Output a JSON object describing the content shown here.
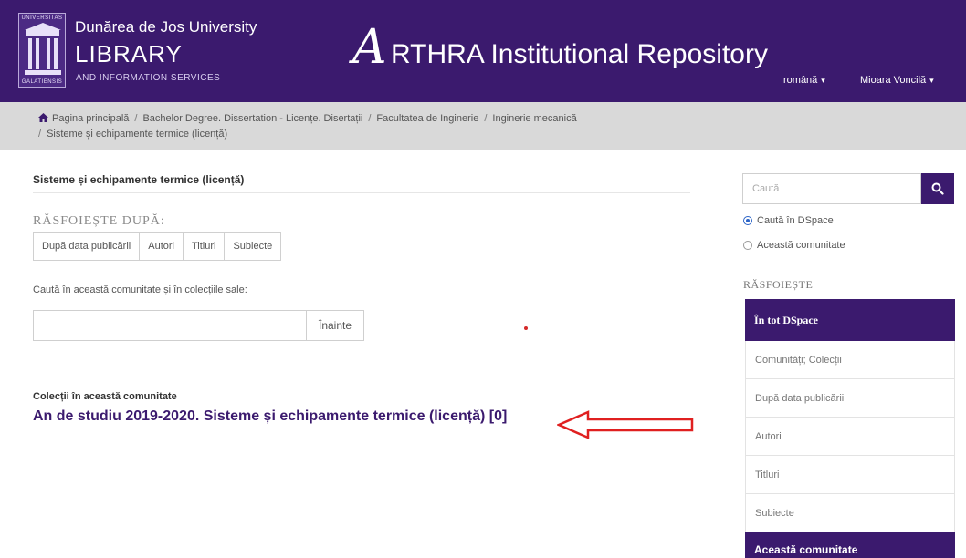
{
  "header": {
    "logo_top": "UNIVERSITAS",
    "logo_bottom": "GALATIENSIS",
    "university": "Dunărea de Jos University",
    "library": "LIBRARY",
    "library_sub": "AND INFORMATION SERVICES",
    "repo_initial": "A",
    "repo_rest": "RTHRA Institutional Repository",
    "language": "română",
    "user": "Mioara Voncilă",
    "brand_color": "#3b1a6e"
  },
  "breadcrumb": {
    "items": [
      "Pagina principală",
      "Bachelor Degree. Dissertation - Licențe. Disertații",
      "Facultatea de Inginerie",
      "Inginerie mecanică"
    ],
    "current": "Sisteme și echipamente termice (licență)"
  },
  "main": {
    "title": "Sisteme și echipamente termice (licență)",
    "browse_heading": "RĂSFOIEȘTE DUPĂ:",
    "browse_buttons": [
      "După data publicării",
      "Autori",
      "Titluri",
      "Subiecte"
    ],
    "search_label": "Caută în această comunitate și în colecțiile sale:",
    "search_value": "",
    "search_button": "Înainte",
    "collections_label": "Colecții în această comunitate",
    "collection_link": "An de studiu 2019-2020. Sisteme și echipamente termice (licență) [0]"
  },
  "sidebar": {
    "search_placeholder": "Caută",
    "radio_options": [
      "Caută în DSpace",
      "Această comunitate"
    ],
    "browse_heading": "RĂSFOIEȘTE",
    "active_item": "În tot DSpace",
    "items": [
      "Comunități; Colecții",
      "După data publicării",
      "Autori",
      "Titluri",
      "Subiecte"
    ],
    "bottom_item": "Această comunitate"
  }
}
